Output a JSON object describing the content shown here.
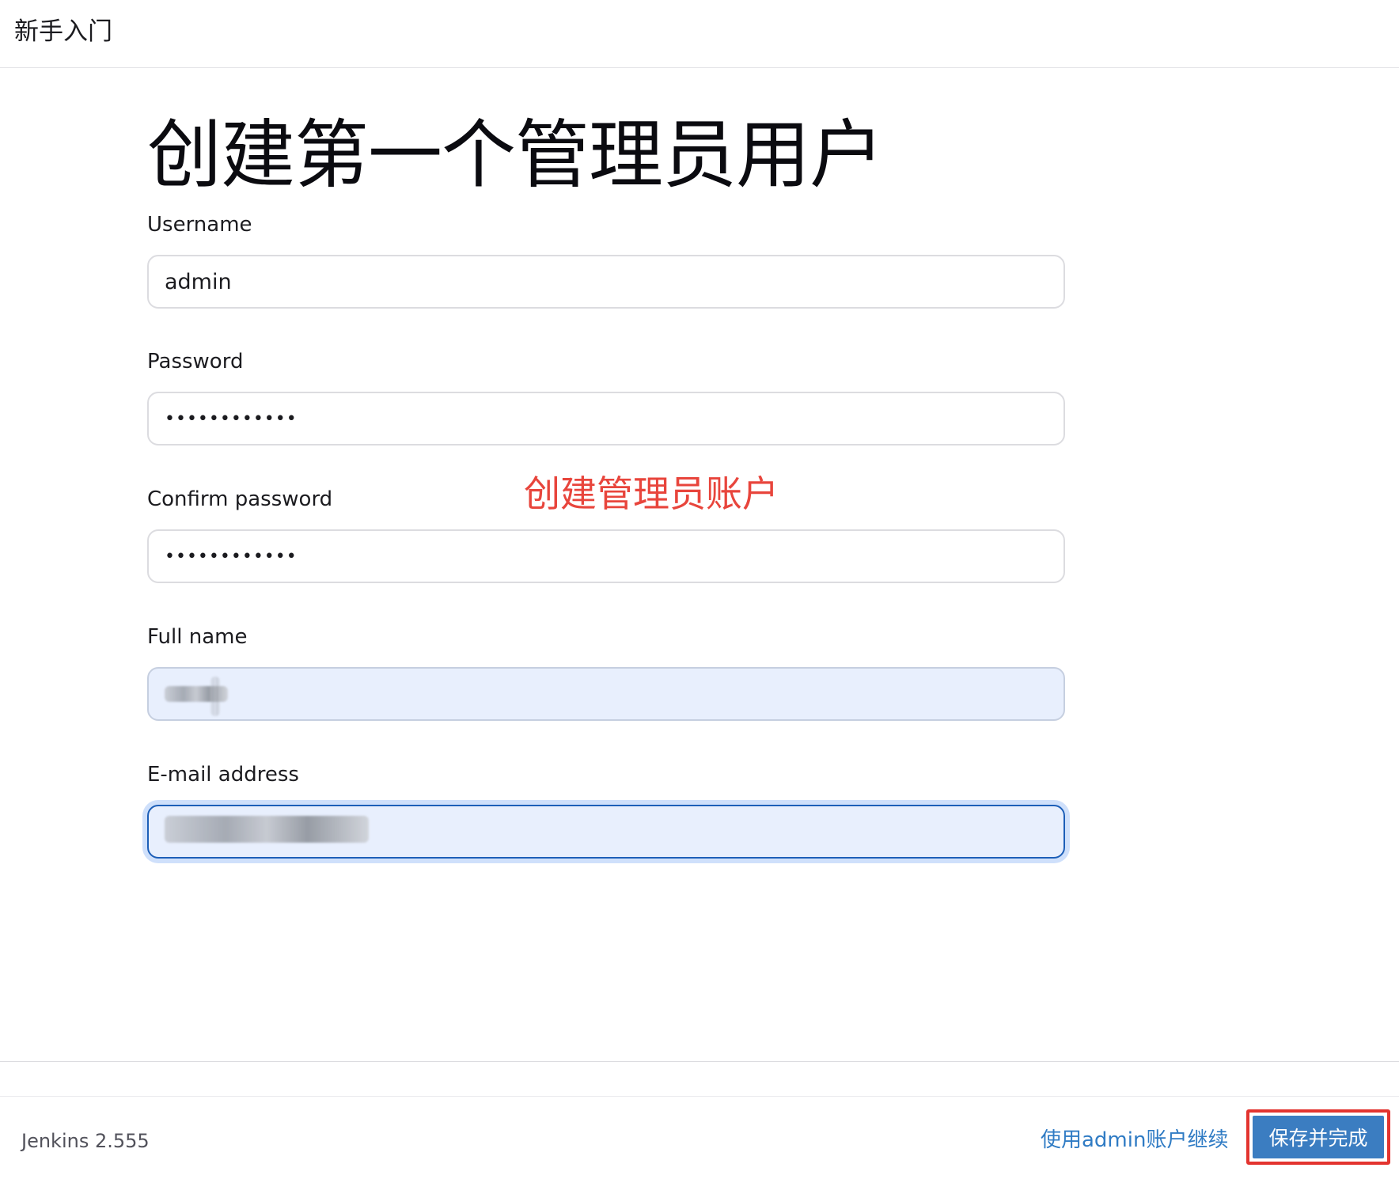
{
  "header": {
    "title": "新手入门"
  },
  "main": {
    "title": "创建第一个管理员用户",
    "fields": {
      "username": {
        "label": "Username",
        "value": "admin"
      },
      "password": {
        "label": "Password",
        "value": "••••••••••••"
      },
      "confirm_password": {
        "label": "Confirm password",
        "value": "••••••••••••"
      },
      "full_name": {
        "label": "Full name",
        "value": ""
      },
      "email": {
        "label": "E-mail address",
        "value": ""
      }
    }
  },
  "annotation": {
    "text": "创建管理员账户",
    "color": "#e8453c"
  },
  "footer": {
    "version": "Jenkins 2.555",
    "continue_link": "使用admin账户继续",
    "save_button": "保存并完成"
  },
  "colors": {
    "accent": "#3b7dc1",
    "link": "#2f7bc4",
    "highlight": "#e3342f",
    "focus_border": "#1d5fb8"
  }
}
